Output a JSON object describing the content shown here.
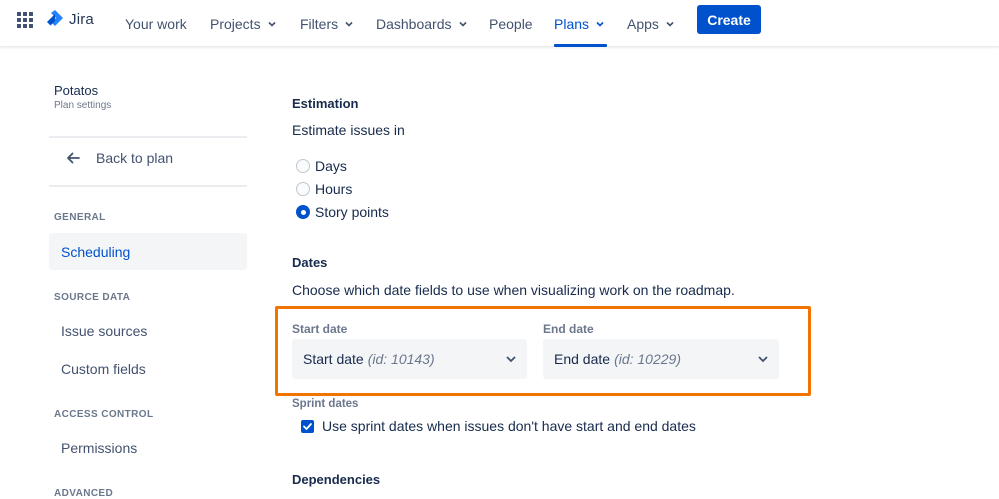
{
  "topnav": {
    "logo_text": "Jira",
    "items": [
      {
        "label": "Your work"
      },
      {
        "label": "Projects"
      },
      {
        "label": "Filters"
      },
      {
        "label": "Dashboards"
      },
      {
        "label": "People"
      },
      {
        "label": "Plans"
      },
      {
        "label": "Apps"
      }
    ],
    "active_item": "Plans",
    "create_label": "Create",
    "accent": "#0052cc"
  },
  "sidebar": {
    "project_name": "Potatos",
    "project_sub": "Plan settings",
    "back_label": "Back to plan",
    "sections": [
      {
        "header": "GENERAL",
        "items": [
          "Scheduling"
        ]
      },
      {
        "header": "SOURCE DATA",
        "items": [
          "Issue sources",
          "Custom fields"
        ]
      },
      {
        "header": "ACCESS CONTROL",
        "items": [
          "Permissions"
        ]
      },
      {
        "header": "ADVANCED",
        "items": []
      }
    ],
    "selected_item": "Scheduling"
  },
  "main": {
    "estimation": {
      "heading": "Estimation",
      "prompt": "Estimate issues in",
      "options": [
        "Days",
        "Hours",
        "Story points"
      ],
      "selected": "Story points"
    },
    "dates": {
      "heading": "Dates",
      "description": "Choose which date fields to use when visualizing work on the roadmap.",
      "start_label": "Start date",
      "start_value": "Start date",
      "start_id": "(id: 10143)",
      "end_label": "End date",
      "end_value": "End date",
      "end_id": "(id: 10229)",
      "highlight_color": "#f27300"
    },
    "sprint": {
      "label": "Sprint dates",
      "checkbox_label": "Use sprint dates when issues don't have start and end dates",
      "checked": true
    },
    "dependencies": {
      "heading": "Dependencies"
    }
  }
}
